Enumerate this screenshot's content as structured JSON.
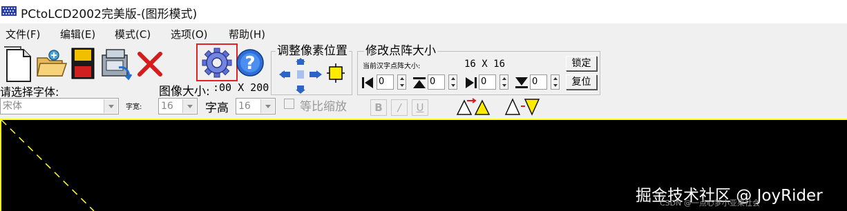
{
  "window": {
    "title": "PCtoLCD2002完美版-(图形模式)"
  },
  "menu": [
    "文件(F)",
    "编辑(E)",
    "模式(C)",
    "选项(O)",
    "帮助(H)"
  ],
  "toolbar": {
    "icons": [
      "new-file-icon",
      "open-folder-icon",
      "save-disk-icon",
      "generate-data-icon",
      "delete-icon",
      "settings-gear-icon",
      "help-icon"
    ],
    "highlighted": "settings-gear-icon",
    "highlight_color": "#e02424"
  },
  "font_select": {
    "label": "请选择字体:",
    "value": "宋体"
  },
  "image_size": {
    "label": "图像大小:",
    "value": ":00 X 200"
  },
  "char_width": {
    "label": "字宽:",
    "value": "16"
  },
  "char_height": {
    "label": "字高",
    "value": "16"
  },
  "proportional": {
    "label": "等比缩放",
    "checked": false
  },
  "format_buttons": [
    "B",
    "/",
    "U"
  ],
  "pixel_position": {
    "title": "调整像素位置"
  },
  "dot_matrix": {
    "title": "修改点阵大小",
    "current_label": "当前汉字点阵大小:",
    "current_value": "16 X 16",
    "lock_button": "锁定",
    "reset_button": "复位",
    "spinners": [
      "0",
      "0",
      "0",
      "0"
    ]
  },
  "canvas": {
    "background": "#000000",
    "border_color": "#ffff22"
  },
  "watermark": {
    "main": "掘金技术社区 @ JoyRider",
    "sub": "CSDN @一点心梦小亚果社会"
  }
}
